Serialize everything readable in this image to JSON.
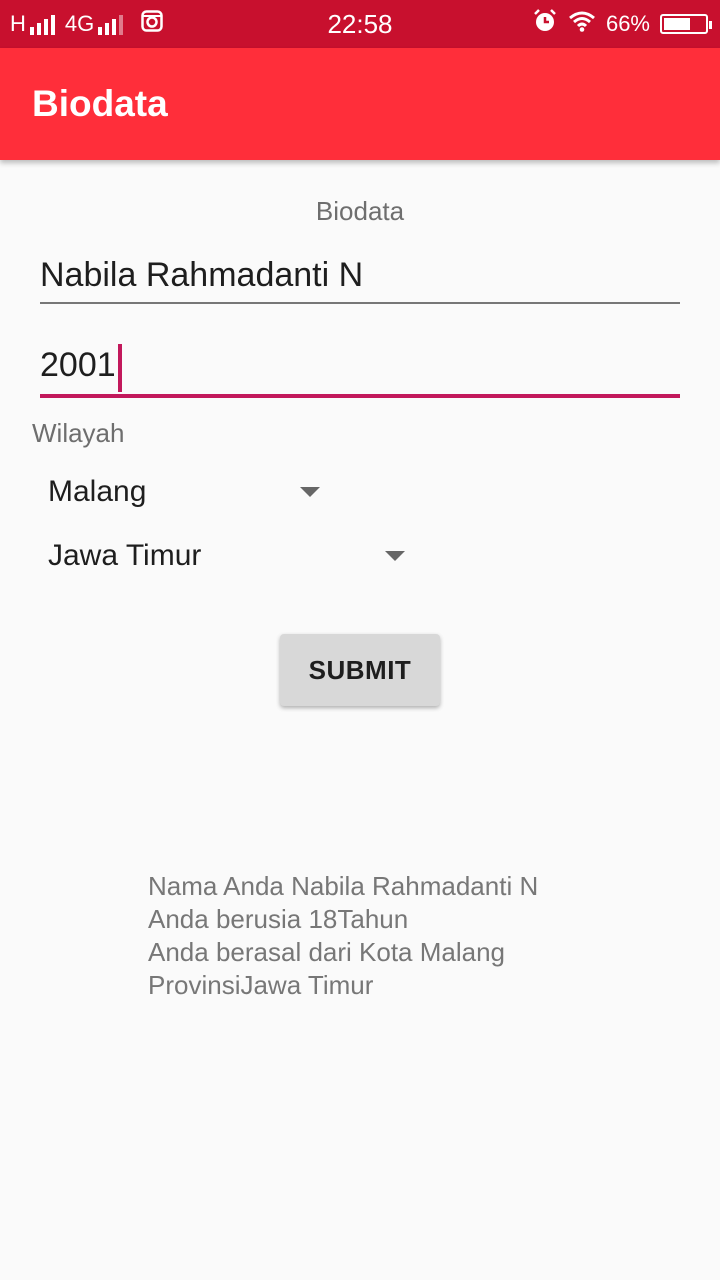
{
  "status_bar": {
    "network_h": "H",
    "network_4g": "4G",
    "time": "22:58",
    "battery": "66%",
    "battery_level": 0.66
  },
  "app_bar": {
    "title": "Biodata"
  },
  "form": {
    "heading": "Biodata",
    "name_value": "Nabila Rahmadanti N",
    "year_value": "2001",
    "wilayah_label": "Wilayah",
    "city_selected": "Malang",
    "province_selected": "Jawa Timur",
    "submit_label": "SUBMIT"
  },
  "result": {
    "line1": "Nama Anda Nabila Rahmadanti N",
    "line2": "Anda berusia 18Tahun",
    "line3": "Anda berasal dari Kota Malang",
    "line4": "ProvinsiJawa Timur"
  },
  "colors": {
    "status_bar": "#c8102e",
    "app_bar": "#ff2e3a",
    "accent": "#c2185b"
  },
  "icons": [
    "signal-icon",
    "instagram-icon",
    "alarm-icon",
    "wifi-icon",
    "battery-icon",
    "dropdown-arrow-icon"
  ]
}
